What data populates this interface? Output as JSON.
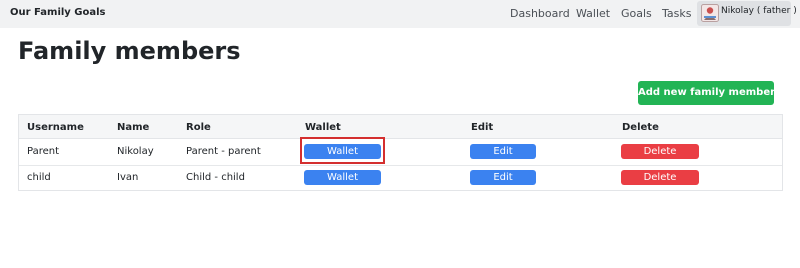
{
  "navbar": {
    "brand": "Our Family Goals",
    "links": [
      "Dashboard",
      "Wallet",
      "Goals",
      "Tasks"
    ],
    "user": "Nikolay ( father )",
    "avatar_icon": "user-avatar-icon"
  },
  "page": {
    "title": "Family members",
    "add_button": "Add new family member"
  },
  "table": {
    "headers": [
      "Username",
      "Name",
      "Role",
      "Wallet",
      "Edit",
      "Delete"
    ],
    "rows": [
      {
        "username": "Parent",
        "name": "Nikolay",
        "role": "Parent - parent",
        "wallet": "Wallet",
        "edit": "Edit",
        "delete": "Delete"
      },
      {
        "username": "child",
        "name": "Ivan",
        "role": "Child - child",
        "wallet": "Wallet",
        "edit": "Edit",
        "delete": "Delete"
      }
    ]
  },
  "colors": {
    "primary": "#3b82f0",
    "success": "#22b455",
    "danger": "#ea3e44",
    "highlight": "#d42f2f"
  }
}
